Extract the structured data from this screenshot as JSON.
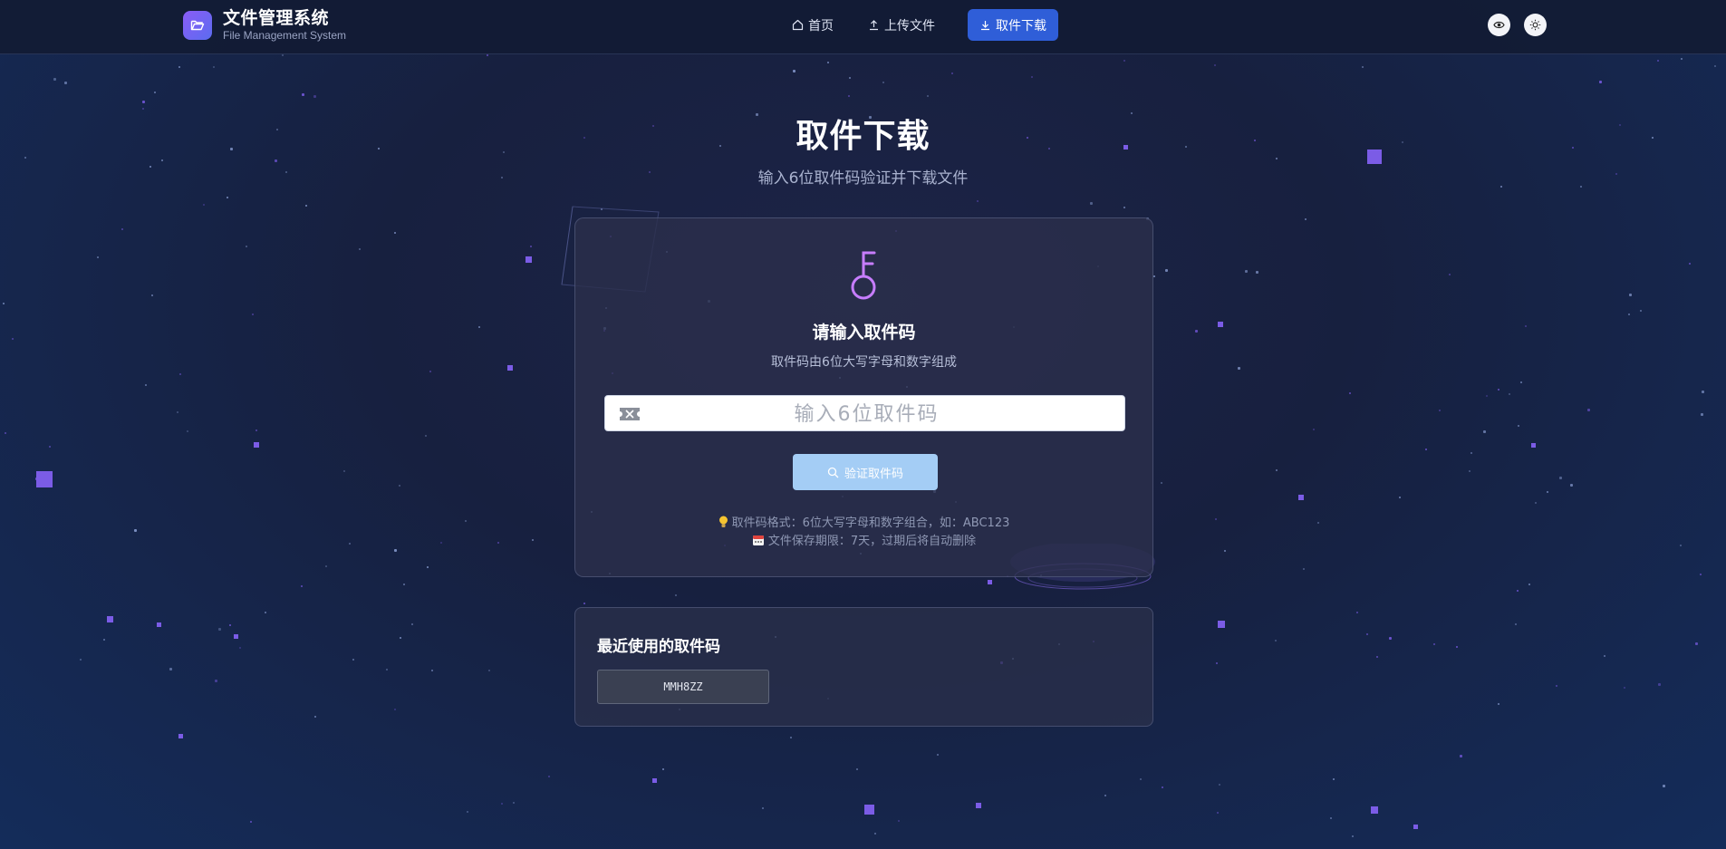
{
  "header": {
    "brand_title": "文件管理系统",
    "brand_subtitle": "File Management System",
    "nav": [
      {
        "label": "首页",
        "icon": "home-icon"
      },
      {
        "label": "上传文件",
        "icon": "upload-icon"
      },
      {
        "label": "取件下载",
        "icon": "download-icon",
        "active": true
      }
    ],
    "actions": [
      {
        "icon": "eye-icon"
      },
      {
        "icon": "sun-icon"
      }
    ]
  },
  "hero": {
    "title": "取件下载",
    "subtitle": "输入6位取件码验证并下载文件"
  },
  "card": {
    "icon": "key-icon",
    "title": "请输入取件码",
    "subtitle": "取件码由6位大写字母和数字组成",
    "input": {
      "value": "",
      "placeholder": "输入6位取件码",
      "icon": "ticket-icon"
    },
    "verify_button": "验证取件码",
    "tips": [
      {
        "icon": "lightbulb-icon",
        "text": "取件码格式：6位大写字母和数字组合，如：ABC123"
      },
      {
        "icon": "calendar-icon",
        "text": "文件保存期限：7天，过期后将自动删除"
      }
    ]
  },
  "recent": {
    "title": "最近使用的取件码",
    "codes": [
      "MMH8ZZ"
    ]
  },
  "colors": {
    "accent": "#2f5ed8",
    "verify_button": "#a4cdf5",
    "star": "#7b5ce6",
    "key_icon": "#c77dff"
  }
}
